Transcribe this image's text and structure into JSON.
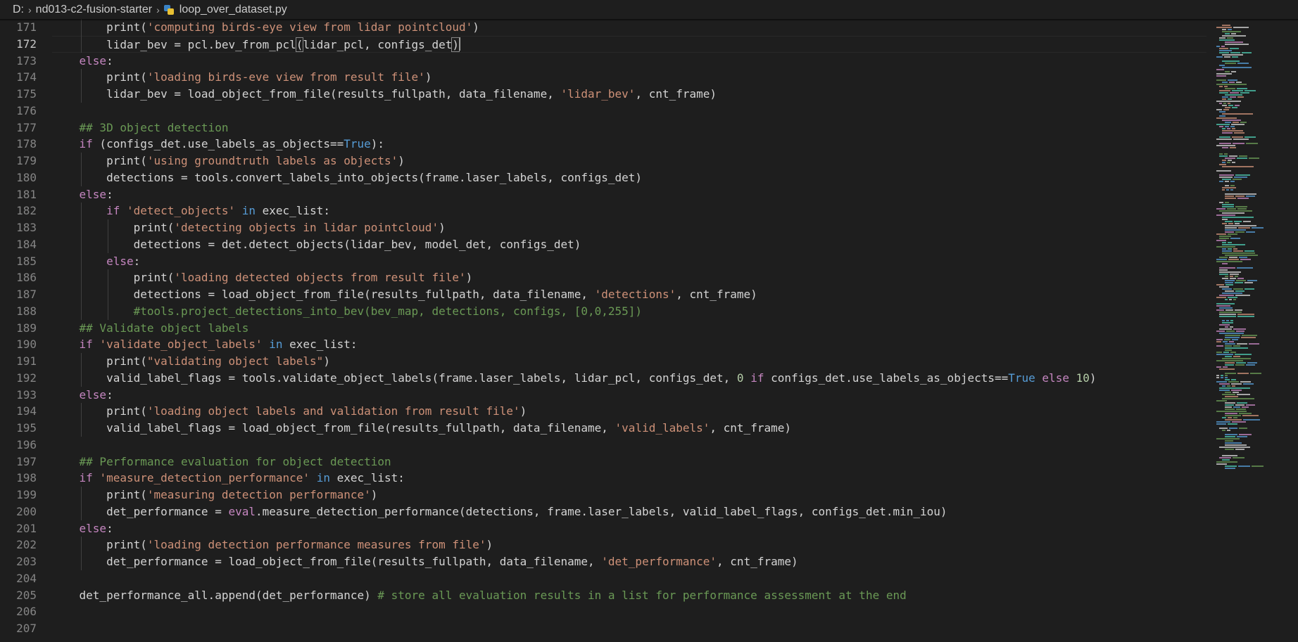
{
  "breadcrumb": {
    "drive": "D:",
    "folder": "nd013-c2-fusion-starter",
    "file": "loop_over_dataset.py",
    "file_icon": "python-icon"
  },
  "editor": {
    "current_line": 172,
    "colors": {
      "background": "#1e1e1e",
      "text": "#d4d4d4",
      "keyword": "#c586c0",
      "string": "#ce9178",
      "comment": "#6a9955",
      "constant": "#569cd6",
      "number": "#b5cea8",
      "line_number": "#858585"
    },
    "lines": [
      {
        "no": "171",
        "indent": 2,
        "tokens": [
          {
            "t": "print",
            "c": ""
          },
          {
            "t": "(",
            "c": ""
          },
          {
            "t": "'computing birds-eye view from lidar pointcloud'",
            "c": "string"
          },
          {
            "t": ")",
            "c": ""
          }
        ]
      },
      {
        "no": "172",
        "indent": 2,
        "current": true,
        "tokens": [
          {
            "t": "lidar_bev = pcl.bev_from_pcl",
            "c": ""
          },
          {
            "t": "(",
            "c": "bracket"
          },
          {
            "t": "lidar_pcl, configs_det",
            "c": ""
          },
          {
            "t": ")",
            "c": "bracket"
          }
        ]
      },
      {
        "no": "173",
        "indent": 1,
        "tokens": [
          {
            "t": "else",
            "c": "keyword"
          },
          {
            "t": ":",
            "c": ""
          }
        ]
      },
      {
        "no": "174",
        "indent": 2,
        "tokens": [
          {
            "t": "print(",
            "c": ""
          },
          {
            "t": "'loading birds-eve view from result file'",
            "c": "string"
          },
          {
            "t": ")",
            "c": ""
          }
        ]
      },
      {
        "no": "175",
        "indent": 2,
        "tokens": [
          {
            "t": "lidar_bev = load_object_from_file(results_fullpath, data_filename, ",
            "c": ""
          },
          {
            "t": "'lidar_bev'",
            "c": "string"
          },
          {
            "t": ", cnt_frame)",
            "c": ""
          }
        ]
      },
      {
        "no": "176",
        "indent": 0,
        "tokens": []
      },
      {
        "no": "177",
        "indent": 1,
        "tokens": [
          {
            "t": "## 3D object detection",
            "c": "comment"
          }
        ]
      },
      {
        "no": "178",
        "indent": 1,
        "tokens": [
          {
            "t": "if",
            "c": "keyword"
          },
          {
            "t": " (configs_det.use_labels_as_objects==",
            "c": ""
          },
          {
            "t": "True",
            "c": "const"
          },
          {
            "t": "):",
            "c": ""
          }
        ]
      },
      {
        "no": "179",
        "indent": 2,
        "tokens": [
          {
            "t": "print(",
            "c": ""
          },
          {
            "t": "'using groundtruth labels as objects'",
            "c": "string"
          },
          {
            "t": ")",
            "c": ""
          }
        ]
      },
      {
        "no": "180",
        "indent": 2,
        "tokens": [
          {
            "t": "detections = tools.convert_labels_into_objects(frame.laser_labels, configs_det)",
            "c": ""
          }
        ]
      },
      {
        "no": "181",
        "indent": 1,
        "tokens": [
          {
            "t": "else",
            "c": "keyword"
          },
          {
            "t": ":",
            "c": ""
          }
        ]
      },
      {
        "no": "182",
        "indent": 2,
        "tokens": [
          {
            "t": "if",
            "c": "keyword"
          },
          {
            "t": " ",
            "c": ""
          },
          {
            "t": "'detect_objects'",
            "c": "string"
          },
          {
            "t": " ",
            "c": ""
          },
          {
            "t": "in",
            "c": "const"
          },
          {
            "t": " exec_list:",
            "c": ""
          }
        ]
      },
      {
        "no": "183",
        "indent": 3,
        "tokens": [
          {
            "t": "print(",
            "c": ""
          },
          {
            "t": "'detecting objects in lidar pointcloud'",
            "c": "string"
          },
          {
            "t": ")",
            "c": ""
          }
        ]
      },
      {
        "no": "184",
        "indent": 3,
        "tokens": [
          {
            "t": "detections = det.detect_objects(lidar_bev, model_det, configs_det)",
            "c": ""
          }
        ]
      },
      {
        "no": "185",
        "indent": 2,
        "tokens": [
          {
            "t": "else",
            "c": "keyword"
          },
          {
            "t": ":",
            "c": ""
          }
        ]
      },
      {
        "no": "186",
        "indent": 3,
        "tokens": [
          {
            "t": "print(",
            "c": ""
          },
          {
            "t": "'loading detected objects from result file'",
            "c": "string"
          },
          {
            "t": ")",
            "c": ""
          }
        ]
      },
      {
        "no": "187",
        "indent": 3,
        "tokens": [
          {
            "t": "detections = load_object_from_file(results_fullpath, data_filename, ",
            "c": ""
          },
          {
            "t": "'detections'",
            "c": "string"
          },
          {
            "t": ", cnt_frame)",
            "c": ""
          }
        ]
      },
      {
        "no": "188",
        "indent": 3,
        "tokens": [
          {
            "t": "#tools.project_detections_into_bev(bev_map, detections, configs, [0,0,255])",
            "c": "comment"
          }
        ]
      },
      {
        "no": "189",
        "indent": 1,
        "tokens": [
          {
            "t": "## Validate object labels",
            "c": "comment"
          }
        ]
      },
      {
        "no": "190",
        "indent": 1,
        "tokens": [
          {
            "t": "if",
            "c": "keyword"
          },
          {
            "t": " ",
            "c": ""
          },
          {
            "t": "'validate_object_labels'",
            "c": "string"
          },
          {
            "t": " ",
            "c": ""
          },
          {
            "t": "in",
            "c": "const"
          },
          {
            "t": " exec_list:",
            "c": ""
          }
        ]
      },
      {
        "no": "191",
        "indent": 2,
        "tokens": [
          {
            "t": "print(",
            "c": ""
          },
          {
            "t": "\"validating object labels\"",
            "c": "string"
          },
          {
            "t": ")",
            "c": ""
          }
        ]
      },
      {
        "no": "192",
        "indent": 2,
        "tokens": [
          {
            "t": "valid_label_flags = tools.validate_object_labels(frame.laser_labels, lidar_pcl, configs_det, ",
            "c": ""
          },
          {
            "t": "0",
            "c": "number"
          },
          {
            "t": " ",
            "c": ""
          },
          {
            "t": "if",
            "c": "keyword"
          },
          {
            "t": " configs_det.use_labels_as_objects==",
            "c": ""
          },
          {
            "t": "True",
            "c": "const"
          },
          {
            "t": " ",
            "c": ""
          },
          {
            "t": "else",
            "c": "keyword"
          },
          {
            "t": " ",
            "c": ""
          },
          {
            "t": "10",
            "c": "number"
          },
          {
            "t": ")",
            "c": ""
          }
        ]
      },
      {
        "no": "193",
        "indent": 1,
        "tokens": [
          {
            "t": "else",
            "c": "keyword"
          },
          {
            "t": ":",
            "c": ""
          }
        ]
      },
      {
        "no": "194",
        "indent": 2,
        "tokens": [
          {
            "t": "print(",
            "c": ""
          },
          {
            "t": "'loading object labels and validation from result file'",
            "c": "string"
          },
          {
            "t": ")",
            "c": ""
          }
        ]
      },
      {
        "no": "195",
        "indent": 2,
        "tokens": [
          {
            "t": "valid_label_flags = load_object_from_file(results_fullpath, data_filename, ",
            "c": ""
          },
          {
            "t": "'valid_labels'",
            "c": "string"
          },
          {
            "t": ", cnt_frame)",
            "c": ""
          }
        ]
      },
      {
        "no": "196",
        "indent": 0,
        "tokens": []
      },
      {
        "no": "197",
        "indent": 1,
        "tokens": [
          {
            "t": "## Performance evaluation for object detection",
            "c": "comment"
          }
        ]
      },
      {
        "no": "198",
        "indent": 1,
        "tokens": [
          {
            "t": "if",
            "c": "keyword"
          },
          {
            "t": " ",
            "c": ""
          },
          {
            "t": "'measure_detection_performance'",
            "c": "string"
          },
          {
            "t": " ",
            "c": ""
          },
          {
            "t": "in",
            "c": "const"
          },
          {
            "t": " exec_list:",
            "c": ""
          }
        ]
      },
      {
        "no": "199",
        "indent": 2,
        "tokens": [
          {
            "t": "print(",
            "c": ""
          },
          {
            "t": "'measuring detection performance'",
            "c": "string"
          },
          {
            "t": ")",
            "c": ""
          }
        ]
      },
      {
        "no": "200",
        "indent": 2,
        "tokens": [
          {
            "t": "det_performance = ",
            "c": ""
          },
          {
            "t": "eval",
            "c": "keyword"
          },
          {
            "t": ".measure_detection_performance(detections, frame.laser_labels, valid_label_flags, configs_det.min_iou)",
            "c": ""
          }
        ]
      },
      {
        "no": "201",
        "indent": 1,
        "tokens": [
          {
            "t": "else",
            "c": "keyword"
          },
          {
            "t": ":",
            "c": ""
          }
        ]
      },
      {
        "no": "202",
        "indent": 2,
        "tokens": [
          {
            "t": "print(",
            "c": ""
          },
          {
            "t": "'loading detection performance measures from file'",
            "c": "string"
          },
          {
            "t": ")",
            "c": ""
          }
        ]
      },
      {
        "no": "203",
        "indent": 2,
        "tokens": [
          {
            "t": "det_performance = load_object_from_file(results_fullpath, data_filename, ",
            "c": ""
          },
          {
            "t": "'det_performance'",
            "c": "string"
          },
          {
            "t": ", cnt_frame)",
            "c": ""
          }
        ]
      },
      {
        "no": "204",
        "indent": 0,
        "tokens": []
      },
      {
        "no": "205",
        "indent": 1,
        "tokens": [
          {
            "t": "det_performance_all.append(det_performance) ",
            "c": ""
          },
          {
            "t": "# store all evaluation results in a list for performance assessment at the end",
            "c": "comment"
          }
        ]
      },
      {
        "no": "206",
        "indent": 0,
        "tokens": []
      },
      {
        "no": "207",
        "indent": 0,
        "tokens": []
      }
    ]
  }
}
